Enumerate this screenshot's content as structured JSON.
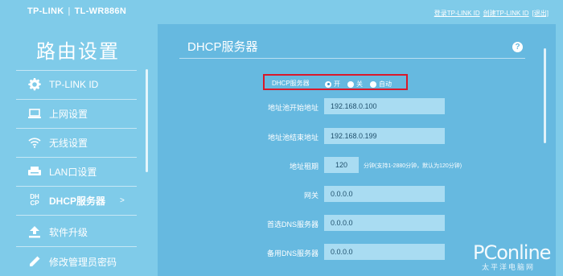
{
  "header": {
    "brand": "TP-LINK",
    "separator": "|",
    "model": "TL-WR886N",
    "links": {
      "login": "登录TP-LINK ID",
      "create": "创建TP-LINK ID",
      "logout": "[退出]"
    }
  },
  "sidebar": {
    "title": "路由设置",
    "items": [
      {
        "label": "TP-LINK ID",
        "icon": "gear-icon"
      },
      {
        "label": "上网设置",
        "icon": "laptop-icon"
      },
      {
        "label": "无线设置",
        "icon": "wifi-icon"
      },
      {
        "label": "LAN口设置",
        "icon": "router-icon"
      },
      {
        "label": "DHCP服务器",
        "icon": "dhcp-icon",
        "icon_text": "DH CP",
        "active": true,
        "arrow": ">"
      },
      {
        "label": "软件升级",
        "icon": "upload-icon"
      },
      {
        "label": "修改管理员密码",
        "icon": "pencil-icon"
      }
    ]
  },
  "main": {
    "title": "DHCP服务器",
    "help": "?",
    "dhcp": {
      "label": "DHCP服务器",
      "options": [
        "开",
        "关",
        "自动"
      ],
      "selected": "开"
    },
    "fields": [
      {
        "label": "地址池开始地址",
        "value": "192.168.0.100"
      },
      {
        "label": "地址池结束地址",
        "value": "192.168.0.199"
      },
      {
        "label": "地址租期",
        "value": "120",
        "hint": "分钟(支持1-2880分钟，默认为120分钟)"
      },
      {
        "label": "网关",
        "value": "0.0.0.0"
      },
      {
        "label": "首选DNS服务器",
        "value": "0.0.0.0"
      },
      {
        "label": "备用DNS服务器",
        "value": "0.0.0.0"
      }
    ]
  },
  "watermark": {
    "main": "PConline",
    "sub": "太平洋电脑网"
  },
  "colors": {
    "background": "#7fcbe9",
    "panel": "#66b9e0",
    "input": "#a9dcf2",
    "highlight": "#d9182a"
  }
}
